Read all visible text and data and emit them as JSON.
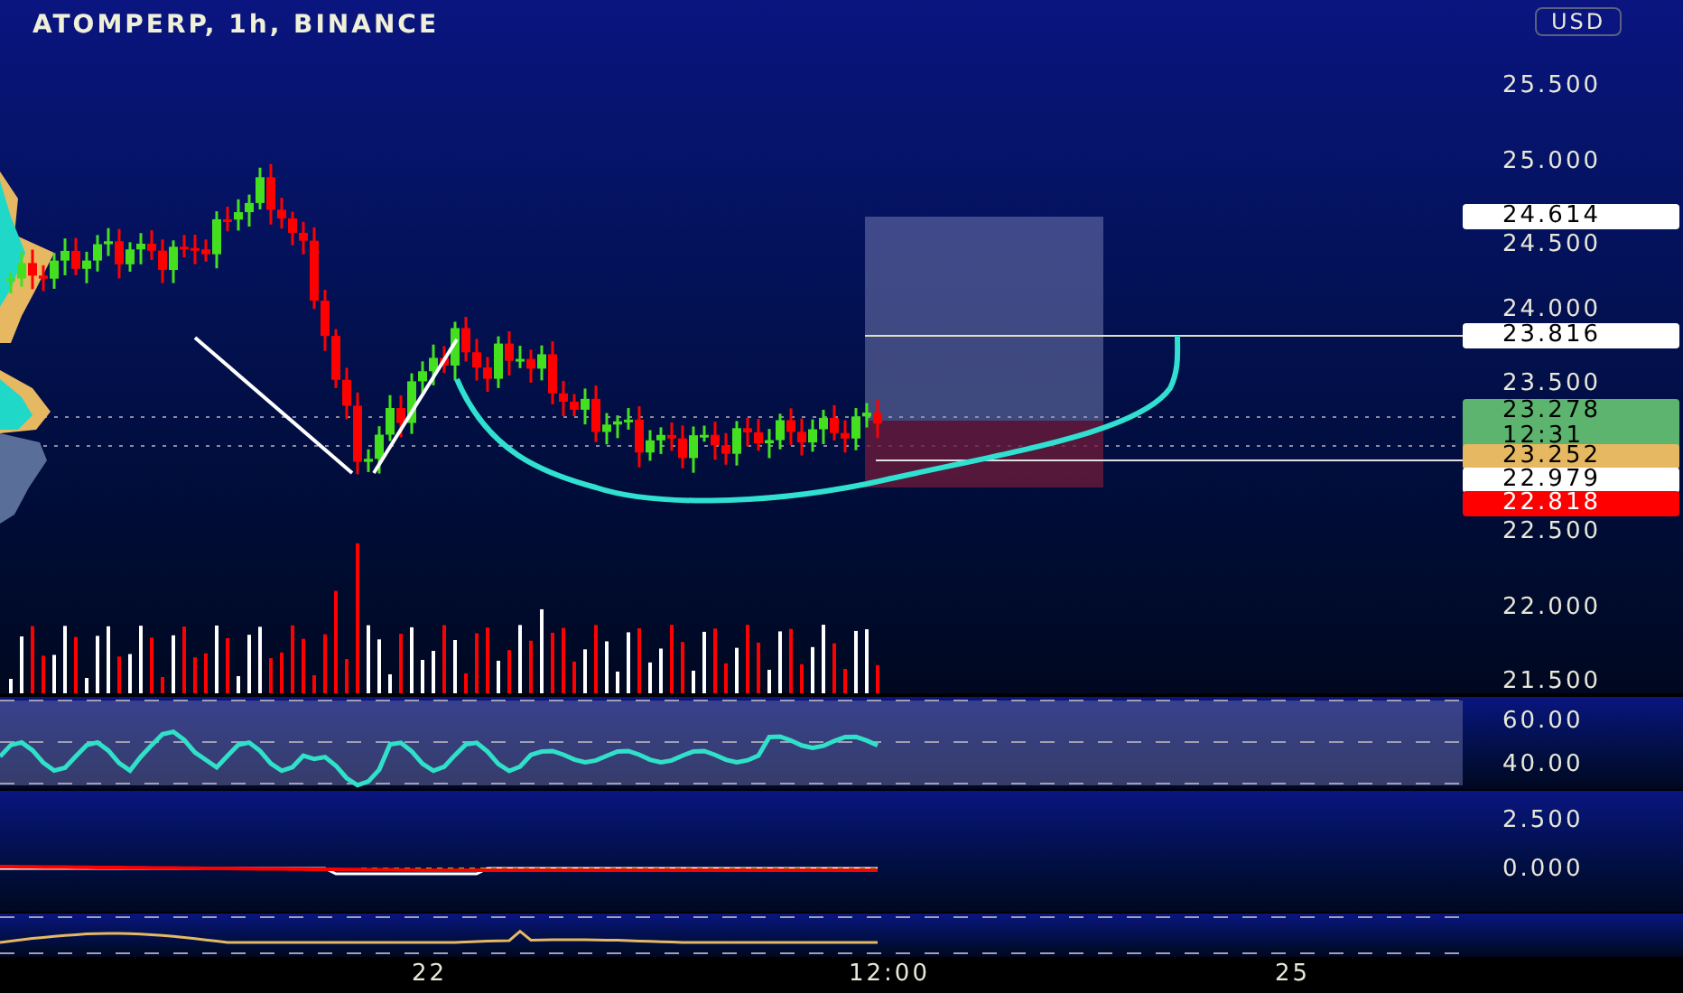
{
  "header": {
    "title": "ATOMPERP, 1h, BINANCE"
  },
  "price_axis": {
    "currency": "USD",
    "ticks": [
      "25.500",
      "25.000",
      "24.500",
      "24.000",
      "23.500",
      "22.500",
      "22.000",
      "21.500"
    ],
    "badges": [
      {
        "text": "24.614",
        "color": "#ffffff"
      },
      {
        "text": "23.816",
        "color": "#ffffff"
      },
      {
        "text": "23.278",
        "countdown": "12:31",
        "color": "#5cb46e"
      },
      {
        "text": "23.252",
        "color": "#e6b862"
      },
      {
        "text": "22.979",
        "color": "#ffffff"
      },
      {
        "text": "22.818",
        "color": "#ff0000"
      }
    ]
  },
  "indicator_panes": [
    {
      "ticks": [
        "60.00",
        "40.00"
      ]
    },
    {
      "ticks": [
        "2.500",
        "0.000"
      ]
    }
  ],
  "time_axis": {
    "labels": [
      "22",
      "12:00",
      "25"
    ]
  }
}
